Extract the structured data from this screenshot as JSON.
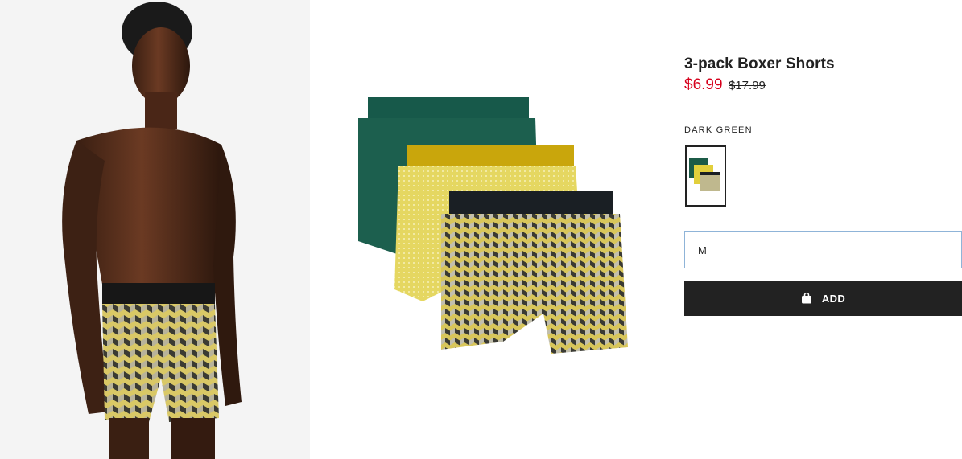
{
  "product": {
    "title": "3-pack Boxer Shorts",
    "price_sale": "$6.99",
    "price_original": "$17.99"
  },
  "color": {
    "selected_label": "DARK GREEN"
  },
  "size": {
    "selected_value": "M"
  },
  "actions": {
    "add_label": "ADD"
  },
  "icons": {
    "add_button_icon": "shopping-bag-icon"
  },
  "colors": {
    "sale_price": "#d6001c",
    "button_bg": "#222222",
    "select_border": "#8fb4d8",
    "swatch_green": "#1c5b47",
    "swatch_yellow": "#e2cf3c",
    "swatch_pattern": "#bfb88e"
  }
}
